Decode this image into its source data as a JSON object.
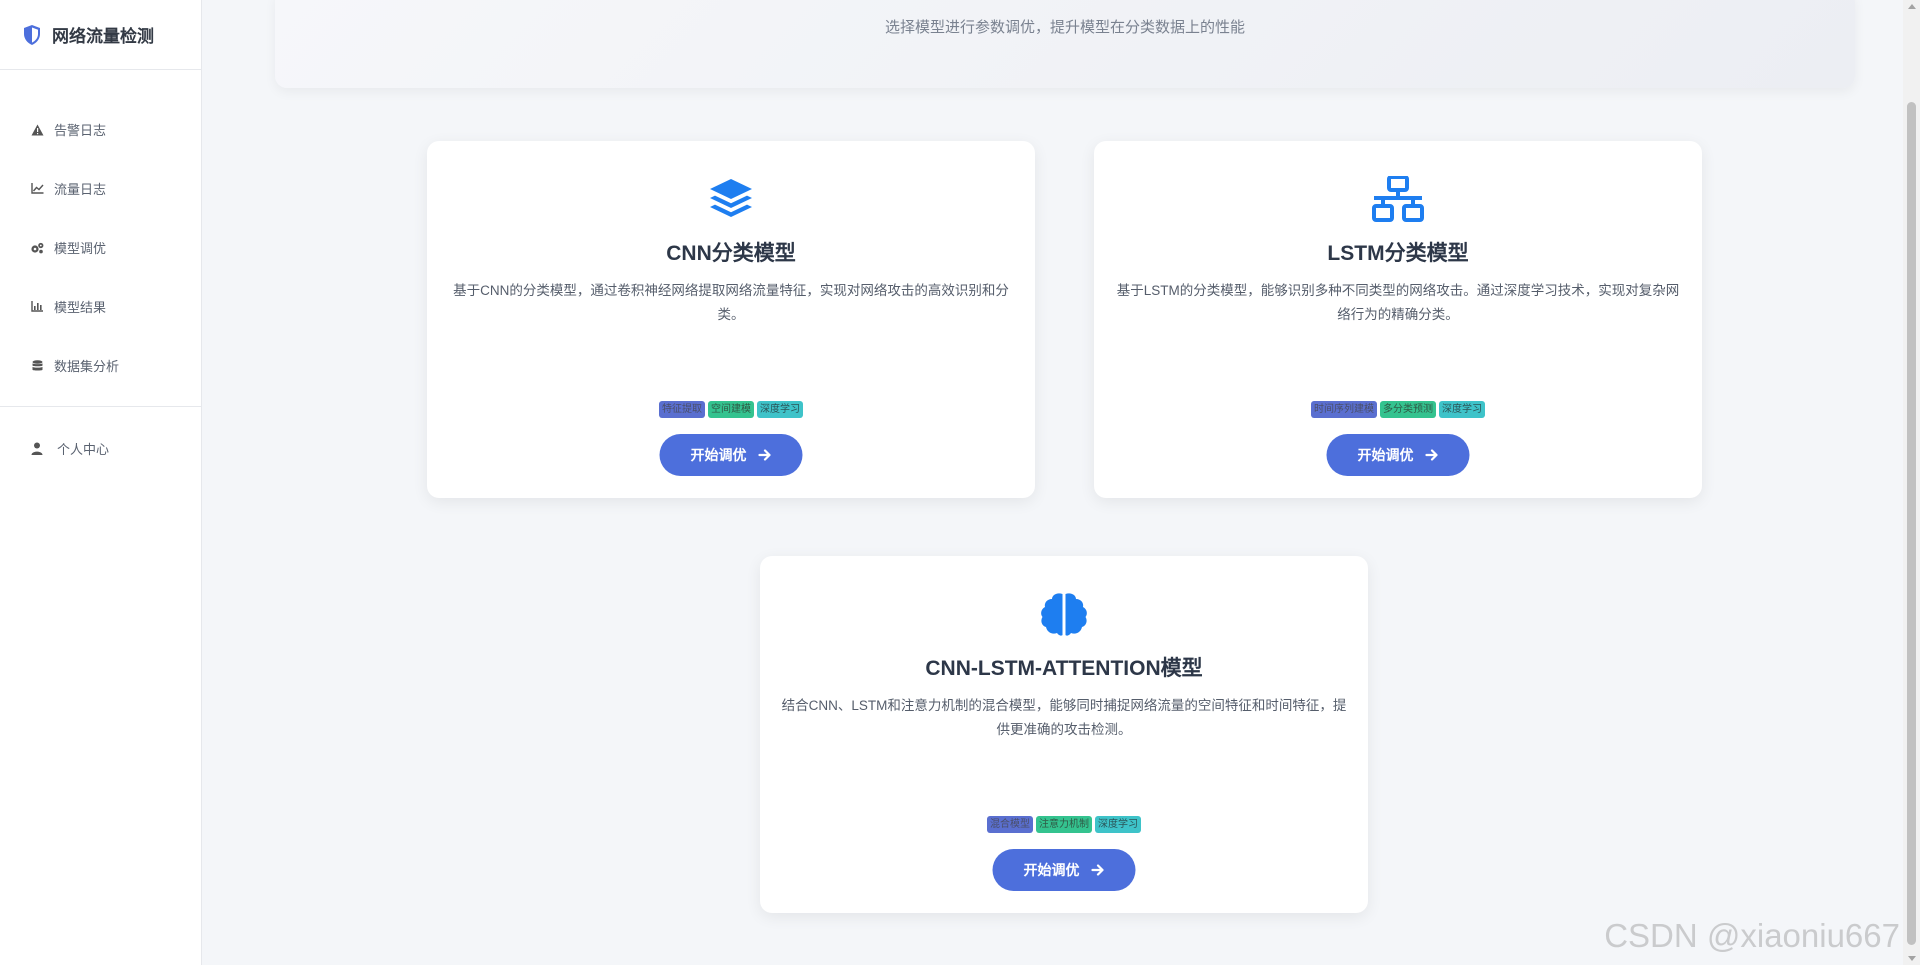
{
  "app": {
    "title": "网络流量检测"
  },
  "sidebar": {
    "items": [
      {
        "label": "告警日志",
        "icon": "warning-icon"
      },
      {
        "label": "流量日志",
        "icon": "line-chart-icon"
      },
      {
        "label": "模型调优",
        "icon": "gears-icon"
      },
      {
        "label": "模型结果",
        "icon": "bar-chart-icon"
      },
      {
        "label": "数据集分析",
        "icon": "database-icon"
      }
    ],
    "profile": {
      "label": "个人中心",
      "icon": "user-icon"
    }
  },
  "banner": {
    "subtitle": "选择模型进行参数调优，提升模型在分类数据上的性能"
  },
  "cards": [
    {
      "icon": "layers-icon",
      "title": "CNN分类模型",
      "description": "基于CNN的分类模型，通过卷积神经网络提取网络流量特征，实现对网络攻击的高效识别和分类。",
      "tags": [
        "特征提取",
        "空间建模",
        "深度学习"
      ],
      "button": "开始调优"
    },
    {
      "icon": "network-icon",
      "title": "LSTM分类模型",
      "description": "基于LSTM的分类模型，能够识别多种不同类型的网络攻击。通过深度学习技术，实现对复杂网络行为的精确分类。",
      "tags": [
        "时间序列建模",
        "多分类预测",
        "深度学习"
      ],
      "button": "开始调优"
    },
    {
      "icon": "brain-icon",
      "title": "CNN-LSTM-ATTENTION模型",
      "description": "结合CNN、LSTM和注意力机制的混合模型，能够同时捕捉网络流量的空间特征和时间特征，提供更准确的攻击检测。",
      "tags": [
        "混合模型",
        "注意力机制",
        "深度学习"
      ],
      "button": "开始调优"
    }
  ],
  "colors": {
    "accent": "#4d6fdc",
    "icon_blue": "#1e7ef0"
  },
  "watermark": "CSDN @xiaoniu667"
}
